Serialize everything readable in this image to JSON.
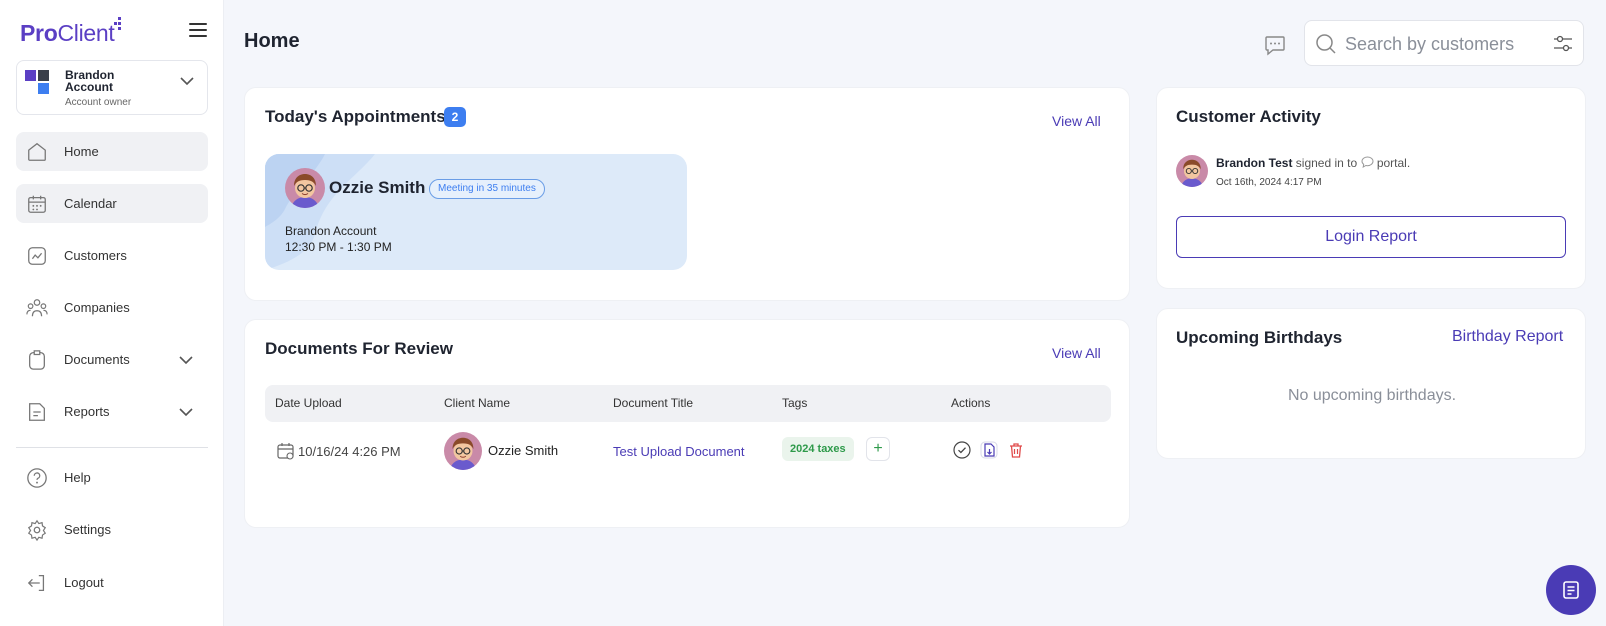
{
  "brand": {
    "logo_pro": "Pro",
    "logo_client": "Client",
    "color": "#5b3fc4"
  },
  "account": {
    "name": "Brandon Account",
    "role": "Account owner"
  },
  "sidebar": {
    "items": [
      {
        "label": "Home",
        "icon": "home-icon"
      },
      {
        "label": "Calendar",
        "icon": "calendar-icon"
      },
      {
        "label": "Customers",
        "icon": "chart-icon"
      },
      {
        "label": "Companies",
        "icon": "people-icon"
      },
      {
        "label": "Documents",
        "icon": "clipboard-icon"
      },
      {
        "label": "Reports",
        "icon": "report-icon"
      },
      {
        "label": "Help",
        "icon": "help-icon"
      },
      {
        "label": "Settings",
        "icon": "gear-icon"
      },
      {
        "label": "Logout",
        "icon": "logout-icon"
      }
    ]
  },
  "header": {
    "title": "Home",
    "search_placeholder": "Search by customers"
  },
  "appointments": {
    "title": "Today's Appointments",
    "count": "2",
    "view_all": "View All",
    "item": {
      "name": "Ozzie Smith",
      "status": "Meeting in 35 minutes",
      "account": "Brandon Account",
      "time": "12:30 PM - 1:30 PM"
    }
  },
  "documents": {
    "title": "Documents For Review",
    "view_all": "View All",
    "columns": [
      "Date Upload",
      "Client Name",
      "Document Title",
      "Tags",
      "Actions"
    ],
    "rows": [
      {
        "date": "10/16/24 4:26 PM",
        "client": "Ozzie Smith",
        "doc_title": "Test Upload Document",
        "tag": "2024 taxes",
        "add_tag": "+"
      }
    ]
  },
  "activity": {
    "title": "Customer Activity",
    "user": "Brandon Test",
    "action_pre": " signed in to ",
    "action_post": " portal.",
    "date": "Oct 16th, 2024 4:17 PM",
    "button": "Login Report"
  },
  "birthdays": {
    "title": "Upcoming Birthdays",
    "report_link": "Birthday Report",
    "empty": "No upcoming birthdays."
  },
  "colors": {
    "accent": "#4a3bb5",
    "blue": "#3d7ef0",
    "tag_green": "#2e9a4a",
    "delete_red": "#e04a4a"
  }
}
